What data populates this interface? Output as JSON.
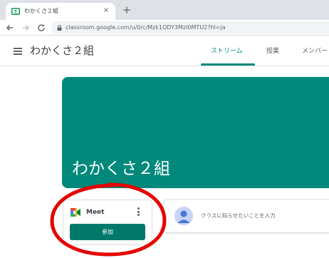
{
  "browser": {
    "tab_title": "わかくさ２組",
    "tab_close": "×",
    "new_tab": "+",
    "url": "classroom.google.com/u/0/c/Mzk1ODY3MzI0MTU2?hl=ja",
    "icons": [
      "classroom-favicon-icon",
      "back-arrow-icon",
      "forward-arrow-icon",
      "reload-icon",
      "lock-icon"
    ]
  },
  "header": {
    "class_title": "わかくさ２組",
    "tabs": [
      {
        "label": "ストリーム",
        "active": true
      },
      {
        "label": "授業",
        "active": false
      },
      {
        "label": "メンバー",
        "active": false
      }
    ]
  },
  "banner": {
    "title": "わかくさ２組",
    "color": "#00897b"
  },
  "meet": {
    "label": "Meet",
    "join_label": "参加",
    "button_color": "#00796b"
  },
  "announce": {
    "placeholder": "クラスに知らせたいことを入力"
  },
  "colors": {
    "accent": "#00897b",
    "annotation": "#e60000"
  }
}
